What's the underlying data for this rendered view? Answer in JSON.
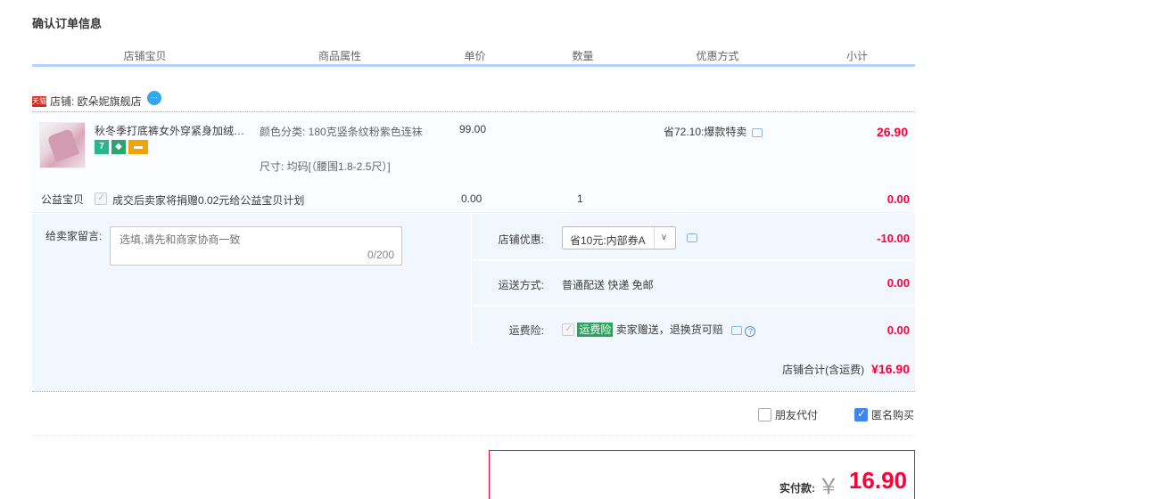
{
  "section_title": "确认订单信息",
  "table_headers": [
    {
      "label": "店铺宝贝",
      "width": 255
    },
    {
      "label": "商品属性",
      "width": 182
    },
    {
      "label": "单价",
      "width": 121
    },
    {
      "label": "数量",
      "width": 121
    },
    {
      "label": "优惠方式",
      "width": 181
    },
    {
      "label": "小计",
      "width": 130
    }
  ],
  "shop": {
    "badge_text": "天猫",
    "label": "店铺: 欧朵妮旗舰店",
    "ww_icon": "wangwang-icon"
  },
  "item": {
    "title": "秋冬季打底裤女外穿紧身加绒螺纹连裤袜",
    "attr_color": "颜色分类: 180克竖条纹粉紫色连袜",
    "attr_size": "尺寸: 均码[（腰围1.8-2.5尺）]",
    "price": "99.00",
    "discount": "省72.10:爆款特卖",
    "subtotal": "26.90",
    "badges": [
      "7",
      "◆",
      "▬"
    ]
  },
  "charity": {
    "label": "公益宝贝",
    "text": "成交后卖家将捐赠0.02元给公益宝贝计划",
    "price": "0.00",
    "qty": "1",
    "subtotal": "0.00"
  },
  "message": {
    "label": "给卖家留言:",
    "placeholder": "选填,请先和商家协商一致",
    "count": "0/200"
  },
  "shop_discount": {
    "label": "店铺优惠:",
    "selected": "省10元:内部券A",
    "amount": "-10.00"
  },
  "shipping": {
    "label": "运送方式:",
    "value": "普通配送 快递 免邮",
    "amount": "0.00"
  },
  "insurance": {
    "label": "运费险:",
    "tag": "运费险",
    "value": "卖家赠送，退换货可赔",
    "amount": "0.00"
  },
  "shop_total": {
    "label": "店铺合计(含运费)",
    "amount": "¥16.90"
  },
  "options": {
    "friend_pay": "朋友代付",
    "anonymous": "匿名购买"
  },
  "payment": {
    "label": "实付款:",
    "currency": "￥",
    "amount": "16.90"
  }
}
